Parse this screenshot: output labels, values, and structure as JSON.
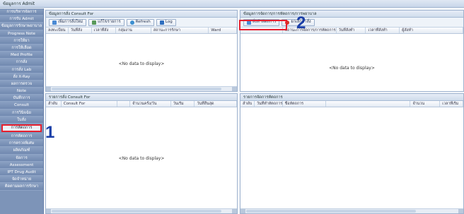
{
  "app": {
    "title": "ข้อมูลการ Admit"
  },
  "sidebar": {
    "items": [
      {
        "label": "การบริหารจัดการ"
      },
      {
        "label": "การรับ Admit"
      },
      {
        "label": "ข้อมูลการรักษาพยาบาล"
      },
      {
        "label": "Progress Note"
      },
      {
        "label": "การให้ยา"
      },
      {
        "label": "การให้เลือด"
      },
      {
        "label": "Med Profile"
      },
      {
        "label": "การสั่ง"
      },
      {
        "label": "การสั่ง Lab"
      },
      {
        "label": "สั่ง X-Ray"
      },
      {
        "label": "ผลการตรวจ"
      },
      {
        "label": "Note"
      },
      {
        "label": "บันทึกการ"
      },
      {
        "label": "Consult"
      },
      {
        "label": "การวินิจฉัย"
      },
      {
        "label": "ใบสั่ง"
      },
      {
        "label": "การหัตถการ"
      },
      {
        "label": "การหัตถการ"
      },
      {
        "label": "การตรวจพิเศษ"
      },
      {
        "label": "ผลิตภัณฑ์"
      },
      {
        "label": "จัดการ"
      },
      {
        "label": "Assessment"
      },
      {
        "label": "IPT Drug Audit"
      },
      {
        "label": "จัดจำหน่าย"
      },
      {
        "label": "ติดตามผลการรักษา"
      }
    ],
    "active_index": 16
  },
  "consult_panel": {
    "title": "ข้อมูลการสั่ง Consult For",
    "buttons": {
      "add": "เพิ่มการสั่งใหม่",
      "edit": "แก้ไขรายการ",
      "refresh": "Refresh",
      "log": "Log"
    },
    "columns": [
      "ลงทะเบียน",
      "วันที่สั่ง",
      "เวลาที่สั่ง",
      "กลุ่มงาน",
      "สถานะการรักษา",
      "Ward"
    ],
    "empty_text": "<No data to display>"
  },
  "procedure_panel": {
    "title": "ข้อมูลการจัดการ/การหัตถการ/การพยาบาล",
    "buttons": {
      "order": "สั่งทำหัตถการ",
      "cancel": "ยกเลิกคำสั่ง"
    },
    "columns": [
      "",
      "สถานะการจัดการ/การหัตถการ",
      "วันที่สั่งทำ",
      "เวลาที่สั่งทำ",
      "ผู้สั่งทำ"
    ],
    "empty_text": "<No data to display>"
  },
  "consult_result_panel": {
    "title": "รายการสั่ง Consult For",
    "columns": [
      "ลำดับ",
      "Consult For",
      "",
      "จำนวนครั้ง/วัน",
      "วันเริ่ม",
      "วันที่สิ้นสุด"
    ],
    "empty_text": "<No data to display>"
  },
  "record_panel": {
    "title": "รายการจัดการหัตถการ",
    "columns": [
      "ลำดับ",
      "วันที่ทำหัตถการ",
      "ชื่อหัตถการ",
      "",
      "จำนวน",
      "เวลาที่เริ่ม"
    ]
  },
  "annotations": {
    "marker1": "1",
    "marker2": "2"
  },
  "colors": {
    "highlight": "#e8202f",
    "marker": "#1b3fa8",
    "sidebar": "#7d94b8"
  }
}
